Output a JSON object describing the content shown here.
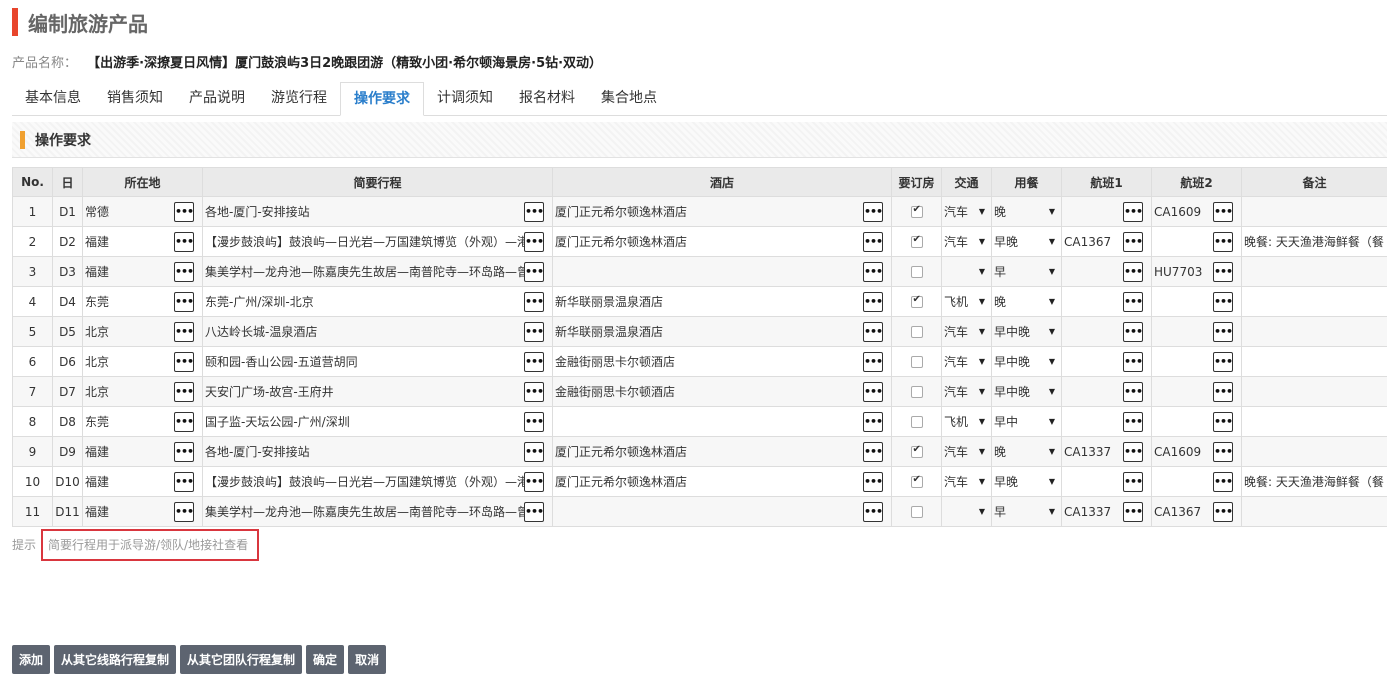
{
  "page": {
    "title": "编制旅游产品"
  },
  "product": {
    "label": "产品名称：",
    "name": "【出游季·深撩夏日风情】厦门鼓浪屿3日2晚跟团游（精致小团·希尔顿海景房·5钻·双动）"
  },
  "tabs": [
    {
      "label": "基本信息",
      "active": false
    },
    {
      "label": "销售须知",
      "active": false
    },
    {
      "label": "产品说明",
      "active": false
    },
    {
      "label": "游览行程",
      "active": false
    },
    {
      "label": "操作要求",
      "active": true
    },
    {
      "label": "计调须知",
      "active": false
    },
    {
      "label": "报名材料",
      "active": false
    },
    {
      "label": "集合地点",
      "active": false
    }
  ],
  "section": {
    "title": "操作要求"
  },
  "table": {
    "headers": [
      "No.",
      "日",
      "所在地",
      "简要行程",
      "酒店",
      "要订房",
      "交通",
      "用餐",
      "航班1",
      "航班2",
      "备注"
    ],
    "rows": [
      {
        "no": "1",
        "day": "D1",
        "loc": "常德",
        "itin": "各地-厦门-安排接站",
        "hotel": "厦门正元希尔顿逸林酒店",
        "book": true,
        "trans": "汽车",
        "meal": "晚",
        "f1": "",
        "f2": "CA1609",
        "note": ""
      },
      {
        "no": "2",
        "day": "D2",
        "loc": "福建",
        "itin": "【漫步鼓浪屿】鼓浪屿—日光岩—万国建筑博览（外观）—港仔后",
        "hotel": "厦门正元希尔顿逸林酒店",
        "book": true,
        "trans": "汽车",
        "meal": "早晚",
        "f1": "CA1367",
        "f2": "",
        "note": "晚餐: 天天渔港海鲜餐（餐"
      },
      {
        "no": "3",
        "day": "D3",
        "loc": "福建",
        "itin": "集美学村—龙舟池—陈嘉庚先生故居—南普陀寺—环岛路—曾厝垵",
        "hotel": "",
        "book": false,
        "trans": "",
        "meal": "早",
        "f1": "",
        "f2": "HU7703",
        "note": ""
      },
      {
        "no": "4",
        "day": "D4",
        "loc": "东莞",
        "itin": "东莞-广州/深圳-北京",
        "hotel": "新华联丽景温泉酒店",
        "book": true,
        "trans": "飞机",
        "meal": "晚",
        "f1": "",
        "f2": "",
        "note": ""
      },
      {
        "no": "5",
        "day": "D5",
        "loc": "北京",
        "itin": "八达岭长城-温泉酒店",
        "hotel": "新华联丽景温泉酒店",
        "book": false,
        "trans": "汽车",
        "meal": "早中晚",
        "f1": "",
        "f2": "",
        "note": ""
      },
      {
        "no": "6",
        "day": "D6",
        "loc": "北京",
        "itin": "颐和园-香山公园-五道营胡同",
        "hotel": "金融街丽思卡尔顿酒店",
        "book": false,
        "trans": "汽车",
        "meal": "早中晚",
        "f1": "",
        "f2": "",
        "note": ""
      },
      {
        "no": "7",
        "day": "D7",
        "loc": "北京",
        "itin": "天安门广场-故宫-王府井",
        "hotel": "金融街丽思卡尔顿酒店",
        "book": false,
        "trans": "汽车",
        "meal": "早中晚",
        "f1": "",
        "f2": "",
        "note": ""
      },
      {
        "no": "8",
        "day": "D8",
        "loc": "东莞",
        "itin": "国子监-天坛公园-广州/深圳",
        "hotel": "",
        "book": false,
        "trans": "飞机",
        "meal": "早中",
        "f1": "",
        "f2": "",
        "note": ""
      },
      {
        "no": "9",
        "day": "D9",
        "loc": "福建",
        "itin": "各地-厦门-安排接站",
        "hotel": "厦门正元希尔顿逸林酒店",
        "book": true,
        "trans": "汽车",
        "meal": "晚",
        "f1": "CA1337",
        "f2": "CA1609",
        "note": ""
      },
      {
        "no": "10",
        "day": "D10",
        "loc": "福建",
        "itin": "【漫步鼓浪屿】鼓浪屿—日光岩—万国建筑博览（外观）—港仔后",
        "hotel": "厦门正元希尔顿逸林酒店",
        "book": true,
        "trans": "汽车",
        "meal": "早晚",
        "f1": "",
        "f2": "",
        "note": "晚餐: 天天渔港海鲜餐（餐"
      },
      {
        "no": "11",
        "day": "D11",
        "loc": "福建",
        "itin": "集美学村—龙舟池—陈嘉庚先生故居—南普陀寺—环岛路—曾厝垵",
        "hotel": "",
        "book": false,
        "trans": "",
        "meal": "早",
        "f1": "CA1337",
        "f2": "CA1367",
        "note": ""
      }
    ]
  },
  "hint": {
    "label": "提示",
    "text": "简要行程用于派导游/领队/地接社查看"
  },
  "buttons": {
    "add": "添加",
    "copy_line": "从其它线路行程复制",
    "copy_team": "从其它团队行程复制",
    "ok": "确定",
    "cancel": "取消"
  },
  "icons": {
    "more": "more-dots-icon",
    "arrow": "dropdown-arrow-icon"
  },
  "colors": {
    "accent": "#e8452c",
    "active_tab": "#2a7ecb",
    "section_mark": "#f0a030",
    "button": "#5d6470",
    "hint_border": "#d9363e"
  }
}
